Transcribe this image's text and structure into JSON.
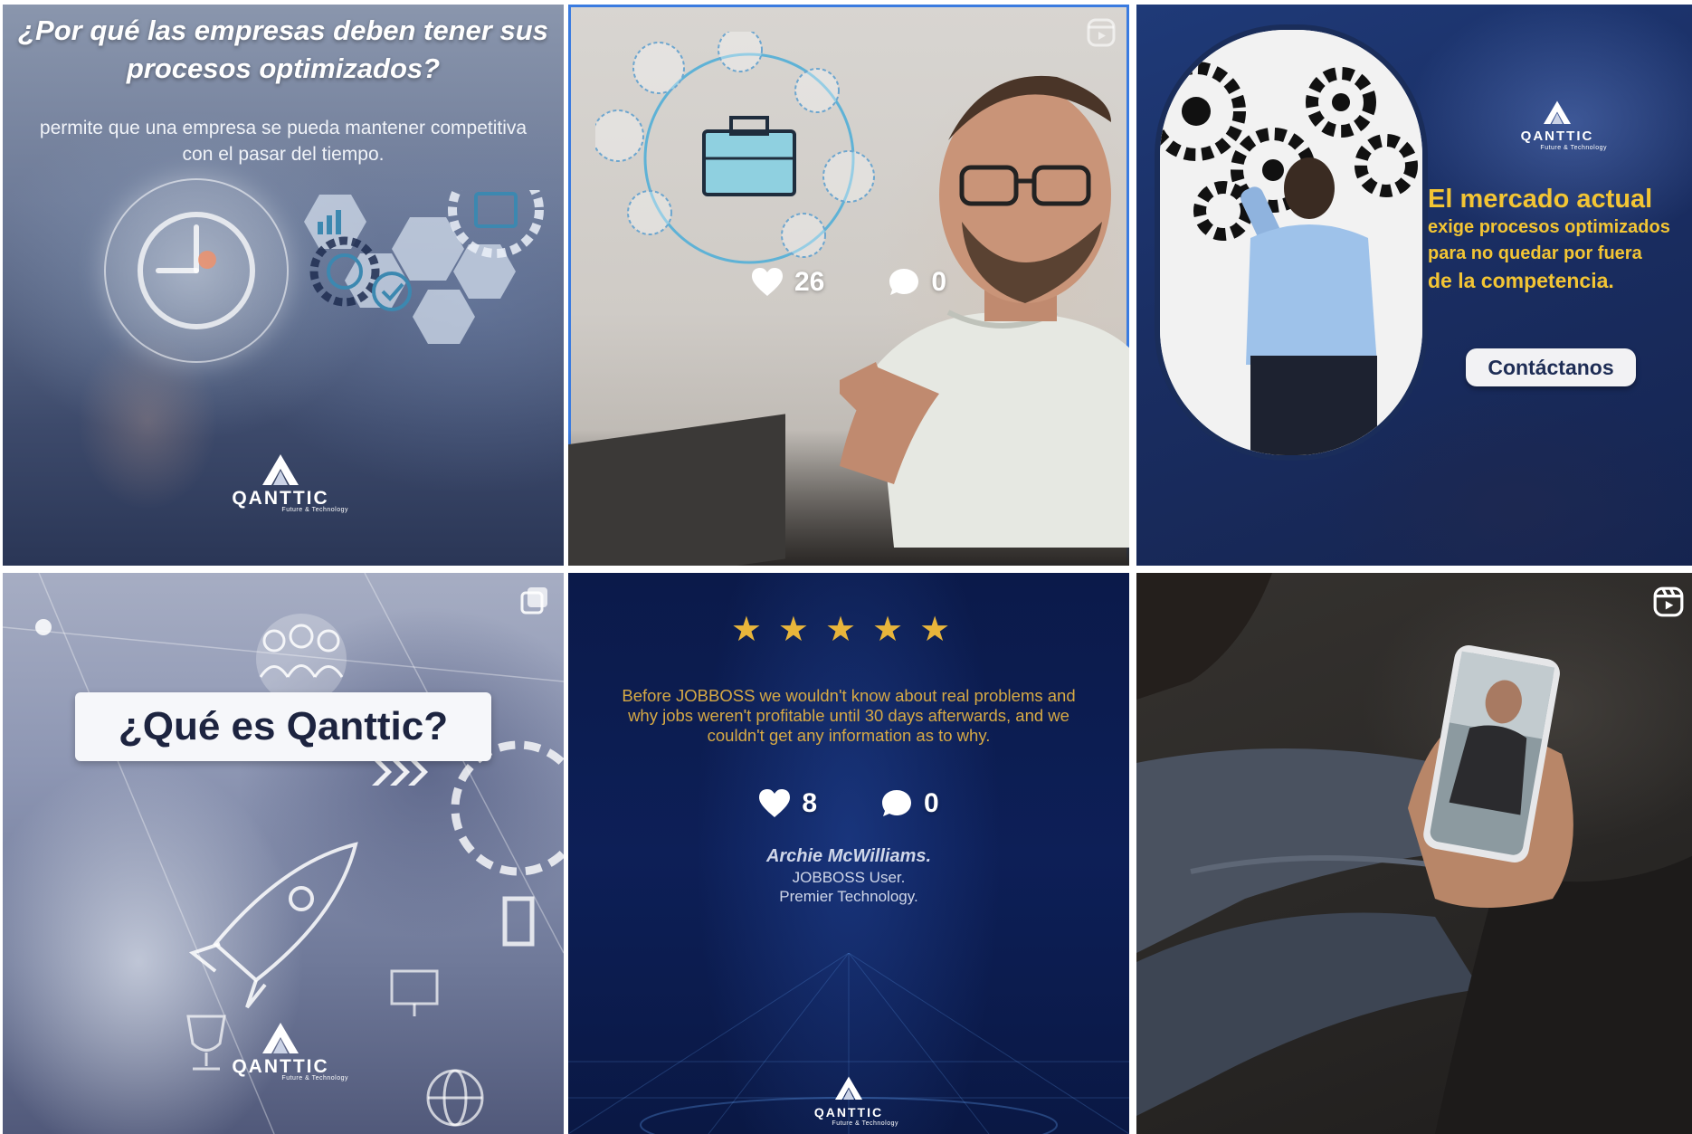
{
  "posts": [
    {
      "title": "¿Por qué las empresas deben tener sus procesos optimizados?",
      "subtitle": "permite que una empresa se pueda mantener competitiva con el pasar del tiempo.",
      "brand": "QANTTIC",
      "brand_tag": "Future & Technology"
    },
    {
      "likes": "26",
      "comments": "0"
    },
    {
      "brand": "QANTTIC",
      "brand_tag": "Future & Technology",
      "headline_1": "El mercado actual",
      "headline_2": "exige procesos optimizados",
      "headline_3": "para no quedar por fuera",
      "headline_4": "de la competencia.",
      "cta": "Contáctanos"
    },
    {
      "label": "¿Qué es Qanttic?",
      "brand": "QANTTIC",
      "brand_tag": "Future & Technology"
    },
    {
      "stars": "★★★★★",
      "quote": "Before JOBBOSS we wouldn't know about real problems and why jobs weren't profitable until 30 days afterwards, and we couldn't get any information as to why.",
      "likes": "8",
      "comments": "0",
      "author": "Archie McWilliams.",
      "role_1": "JOBBOSS User.",
      "role_2": "Premier Technology.",
      "brand": "QANTTIC",
      "brand_tag": "Future & Technology"
    },
    {}
  ],
  "icons": {
    "like": "heart-icon",
    "comment": "comment-bubble-icon",
    "reel": "reel-icon",
    "carousel": "carousel-icon"
  },
  "colors": {
    "selection": "#3a7be0",
    "gold": "#f3c534"
  }
}
